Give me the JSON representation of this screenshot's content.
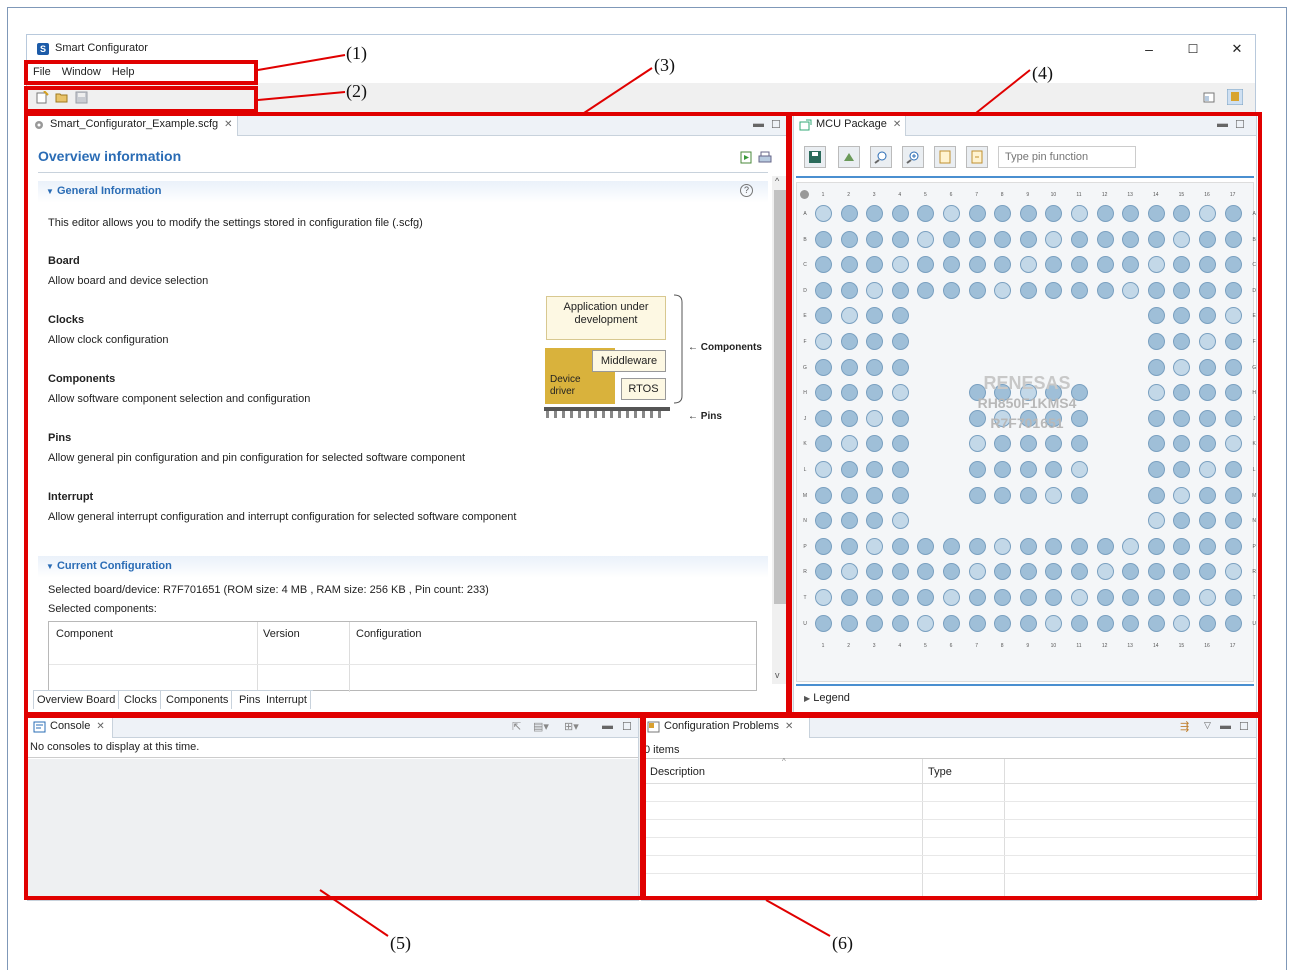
{
  "window": {
    "title": "Smart Configurator",
    "minimize": "–",
    "maximize": "☐",
    "close": "✕"
  },
  "menu": [
    "File",
    "Window",
    "Help"
  ],
  "callouts": {
    "c1": "(1)",
    "c2": "(2)",
    "c3": "(3)",
    "c4": "(4)",
    "c5": "(5)",
    "c6": "(6)"
  },
  "editor": {
    "tab_label": "Smart_Configurator_Example.scfg",
    "heading": "Overview information",
    "general_section": "General Information",
    "intro": "This editor allows you to modify the settings stored in configuration file (.scfg)",
    "items": [
      {
        "title": "Board",
        "desc": "Allow board and device selection"
      },
      {
        "title": "Clocks",
        "desc": "Allow clock configuration"
      },
      {
        "title": "Components",
        "desc": "Allow software component selection and configuration"
      },
      {
        "title": "Pins",
        "desc": "Allow general pin configuration and pin configuration for selected software component"
      },
      {
        "title": "Interrupt",
        "desc": "Allow general interrupt configuration and interrupt configuration for selected software component"
      }
    ],
    "diagram": {
      "app": "Application under development",
      "middleware": "Middleware",
      "device_driver": "Device driver",
      "rtos": "RTOS",
      "components_label": "Components",
      "pins_label": "Pins"
    },
    "current_section": "Current Configuration",
    "selected_device_label": "Selected board/device:",
    "selected_device_value": "R7F701651 (ROM size: 4 MB , RAM size: 256 KB , Pin count: 233)",
    "selected_components_label": "Selected components:",
    "table_headers": [
      "Component",
      "Version",
      "Configuration"
    ],
    "bottom_tabs": [
      "Overview",
      "Board",
      "Clocks",
      "Components",
      "Pins",
      "Interrupt"
    ]
  },
  "mcu": {
    "tab_label": "MCU Package",
    "search_placeholder": "Type pin function",
    "chip_name": "RH850F1KMS4",
    "chip_part": "R7F701651",
    "brand": "RENESAS",
    "legend": "Legend",
    "col_numbers": [
      "1",
      "2",
      "3",
      "4",
      "5",
      "6",
      "7",
      "8",
      "9",
      "10",
      "11",
      "12",
      "13",
      "14",
      "15",
      "16",
      "17"
    ],
    "row_letters": [
      "A",
      "B",
      "C",
      "D",
      "E",
      "F",
      "G",
      "H",
      "J",
      "K",
      "L",
      "M",
      "N",
      "P",
      "R",
      "T",
      "U"
    ]
  },
  "console": {
    "tab_label": "Console",
    "message": "No consoles to display at this time."
  },
  "problems": {
    "tab_label": "Configuration Problems",
    "count": "0 items",
    "headers": [
      "Description",
      "Type"
    ]
  }
}
